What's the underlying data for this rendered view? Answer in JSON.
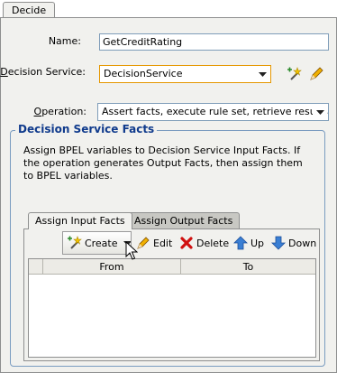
{
  "tab": {
    "label": "Decide"
  },
  "form": {
    "name_label": "Name:",
    "name_value": "GetCreditRating",
    "decision_service_label_first": "D",
    "decision_service_label_rest": "ecision Service:",
    "decision_service_value": "DecisionService",
    "operation_label_first": "O",
    "operation_label_rest": "peration:",
    "operation_value": "Assert facts, execute rule set, retrieve results..."
  },
  "facts": {
    "title": "Decision Service Facts",
    "description": "Assign BPEL variables to Decision Service Input Facts. If the operation generates Output Facts, then assign them to BPEL variables.",
    "tabs": [
      {
        "label": "Assign Input Facts",
        "active": true
      },
      {
        "label": "Assign Output Facts",
        "active": false
      }
    ],
    "toolbar": {
      "create": "Create",
      "edit": "Edit",
      "delete": "Delete",
      "up": "Up",
      "down": "Down"
    },
    "table": {
      "columns": [
        "From",
        "To"
      ]
    }
  },
  "colors": {
    "group_title": "#0f3a8c",
    "panel_bg": "#f1f1ee",
    "focus_border": "#e59700"
  }
}
